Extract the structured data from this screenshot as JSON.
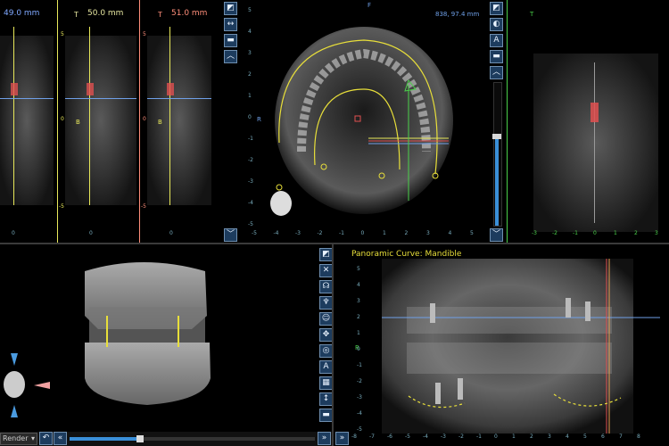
{
  "cross_sections": [
    {
      "label": "49.0 mm",
      "color": "#7fa8ff"
    },
    {
      "label": "50.0 mm",
      "color": "#e6e6a0",
      "marker": "T"
    },
    {
      "label": "51.0 mm",
      "color": "#ff8e7a",
      "marker": "T"
    }
  ],
  "axial": {
    "orientation": "F",
    "coordinate": "838, 97.4 mm"
  },
  "sagittal": {
    "marker": "T"
  },
  "panoramic": {
    "title": "Panoramic Curve: Mandible",
    "top_marker": "T",
    "side_marker": "R"
  },
  "render": {
    "mode_label": "Render",
    "dropdown_icon": "chevron-down-icon"
  },
  "markers": {
    "b1": "B",
    "b2": "B",
    "r": "R"
  },
  "ruler_values": {
    "left": [
      "5",
      "0",
      "-5"
    ],
    "axial_bottom": [
      "-5",
      "-4",
      "-3",
      "-2",
      "-1",
      "0",
      "1",
      "2",
      "3",
      "4",
      "5"
    ],
    "sagittal_bottom": [
      "-3",
      "-2",
      "-1",
      "0",
      "1",
      "2",
      "3"
    ],
    "pano_bottom": [
      "-8",
      "-7",
      "-6",
      "-5",
      "-4",
      "-3",
      "-2",
      "-1",
      "0",
      "1",
      "2",
      "3",
      "4",
      "5",
      "6",
      "7",
      "8"
    ],
    "pano_left": [
      "5",
      "4",
      "3",
      "2",
      "1",
      "0",
      "-1",
      "-2",
      "-3",
      "-4",
      "-5"
    ],
    "axial_left": [
      "5",
      "4",
      "3",
      "2",
      "1",
      "0",
      "-1",
      "-2",
      "-3",
      "-4",
      "-5"
    ],
    "section_bottom": "0"
  },
  "colors": {
    "accent": "#3a8fd8",
    "tool_bg": "#1d3c5e",
    "curve": "#e8df3a",
    "implant": "#e05050",
    "slice": "#6fa0e8",
    "axis": "#e8e85a"
  }
}
